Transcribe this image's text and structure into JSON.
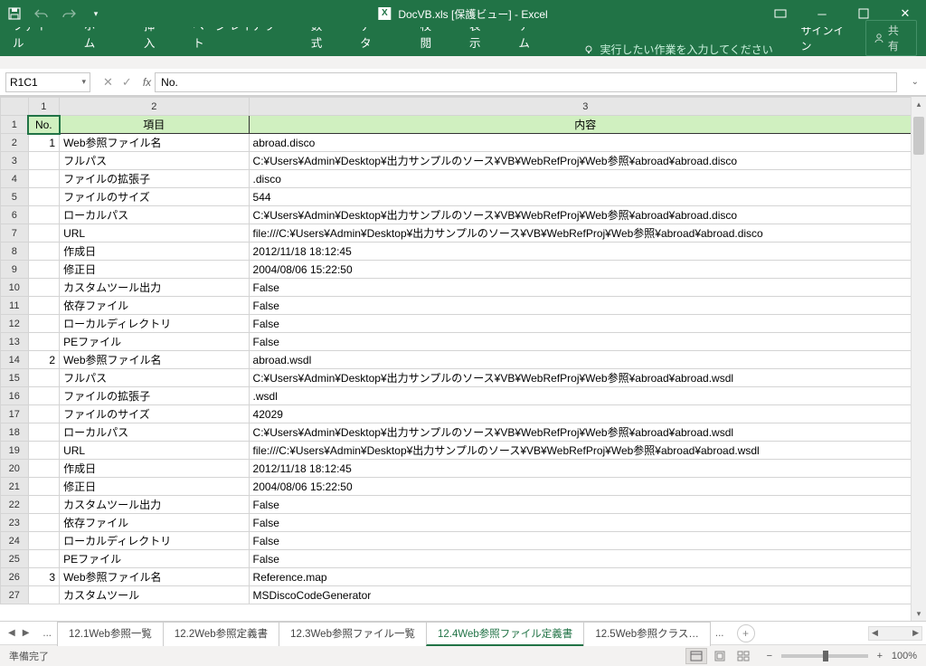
{
  "title": "DocVB.xls  [保護ビュー] - Excel",
  "qat": {
    "save": "💾",
    "undo": "↶",
    "redo": "↷"
  },
  "ribbon": {
    "tabs": [
      "ファイル",
      "ホーム",
      "挿入",
      "ページ レイアウト",
      "数式",
      "データ",
      "校閲",
      "表示",
      "チーム"
    ],
    "tell_me_placeholder": "実行したい作業を入力してください",
    "signin": "サインイン",
    "share": "共有"
  },
  "formula": {
    "name_box": "R1C1",
    "fx_label": "fx",
    "value": "No."
  },
  "columns": [
    "1",
    "2",
    "3"
  ],
  "header_row": {
    "no": "No.",
    "item": "項目",
    "content": "内容"
  },
  "rows": [
    {
      "n": "1",
      "no": "1",
      "item": "Web参照ファイル名",
      "val": "abroad.disco"
    },
    {
      "n": "2",
      "no": "",
      "item": "フルパス",
      "val": "C:¥Users¥Admin¥Desktop¥出力サンプルのソース¥VB¥WebRefProj¥Web参照¥abroad¥abroad.disco"
    },
    {
      "n": "3",
      "no": "",
      "item": "ファイルの拡張子",
      "val": ".disco"
    },
    {
      "n": "4",
      "no": "",
      "item": "ファイルのサイズ",
      "val": "544"
    },
    {
      "n": "5",
      "no": "",
      "item": "ローカルパス",
      "val": "C:¥Users¥Admin¥Desktop¥出力サンプルのソース¥VB¥WebRefProj¥Web参照¥abroad¥abroad.disco"
    },
    {
      "n": "6",
      "no": "",
      "item": "URL",
      "val": "file:///C:¥Users¥Admin¥Desktop¥出力サンプルのソース¥VB¥WebRefProj¥Web参照¥abroad¥abroad.disco"
    },
    {
      "n": "7",
      "no": "",
      "item": "作成日",
      "val": "2012/11/18 18:12:45"
    },
    {
      "n": "8",
      "no": "",
      "item": "修正日",
      "val": "2004/08/06 15:22:50"
    },
    {
      "n": "9",
      "no": "",
      "item": "カスタムツール出力",
      "val": "False"
    },
    {
      "n": "10",
      "no": "",
      "item": "依存ファイル",
      "val": "False"
    },
    {
      "n": "11",
      "no": "",
      "item": "ローカルディレクトリ",
      "val": "False"
    },
    {
      "n": "12",
      "no": "",
      "item": "PEファイル",
      "val": "False"
    },
    {
      "n": "13",
      "no": "2",
      "item": "Web参照ファイル名",
      "val": "abroad.wsdl"
    },
    {
      "n": "14",
      "no": "",
      "item": "フルパス",
      "val": "C:¥Users¥Admin¥Desktop¥出力サンプルのソース¥VB¥WebRefProj¥Web参照¥abroad¥abroad.wsdl"
    },
    {
      "n": "15",
      "no": "",
      "item": "ファイルの拡張子",
      "val": ".wsdl"
    },
    {
      "n": "16",
      "no": "",
      "item": "ファイルのサイズ",
      "val": "42029"
    },
    {
      "n": "17",
      "no": "",
      "item": "ローカルパス",
      "val": "C:¥Users¥Admin¥Desktop¥出力サンプルのソース¥VB¥WebRefProj¥Web参照¥abroad¥abroad.wsdl"
    },
    {
      "n": "18",
      "no": "",
      "item": "URL",
      "val": "file:///C:¥Users¥Admin¥Desktop¥出力サンプルのソース¥VB¥WebRefProj¥Web参照¥abroad¥abroad.wsdl"
    },
    {
      "n": "19",
      "no": "",
      "item": "作成日",
      "val": "2012/11/18 18:12:45"
    },
    {
      "n": "20",
      "no": "",
      "item": "修正日",
      "val": "2004/08/06 15:22:50"
    },
    {
      "n": "21",
      "no": "",
      "item": "カスタムツール出力",
      "val": "False"
    },
    {
      "n": "22",
      "no": "",
      "item": "依存ファイル",
      "val": "False"
    },
    {
      "n": "23",
      "no": "",
      "item": "ローカルディレクトリ",
      "val": "False"
    },
    {
      "n": "24",
      "no": "",
      "item": "PEファイル",
      "val": "False"
    },
    {
      "n": "25",
      "no": "3",
      "item": "Web参照ファイル名",
      "val": "Reference.map"
    },
    {
      "n": "26",
      "no": "",
      "item": "カスタムツール",
      "val": "MSDiscoCodeGenerator"
    }
  ],
  "sheet_tabs": {
    "ellipsis": "...",
    "tabs": [
      {
        "label": "12.1Web参照一覧",
        "active": false
      },
      {
        "label": "12.2Web参照定義書",
        "active": false
      },
      {
        "label": "12.3Web参照ファイル一覧",
        "active": false
      },
      {
        "label": "12.4Web参照ファイル定義書",
        "active": true
      },
      {
        "label": "12.5Web参照クラス…",
        "active": false
      }
    ],
    "more": "..."
  },
  "status": {
    "ready": "準備完了",
    "zoom": "100%"
  }
}
